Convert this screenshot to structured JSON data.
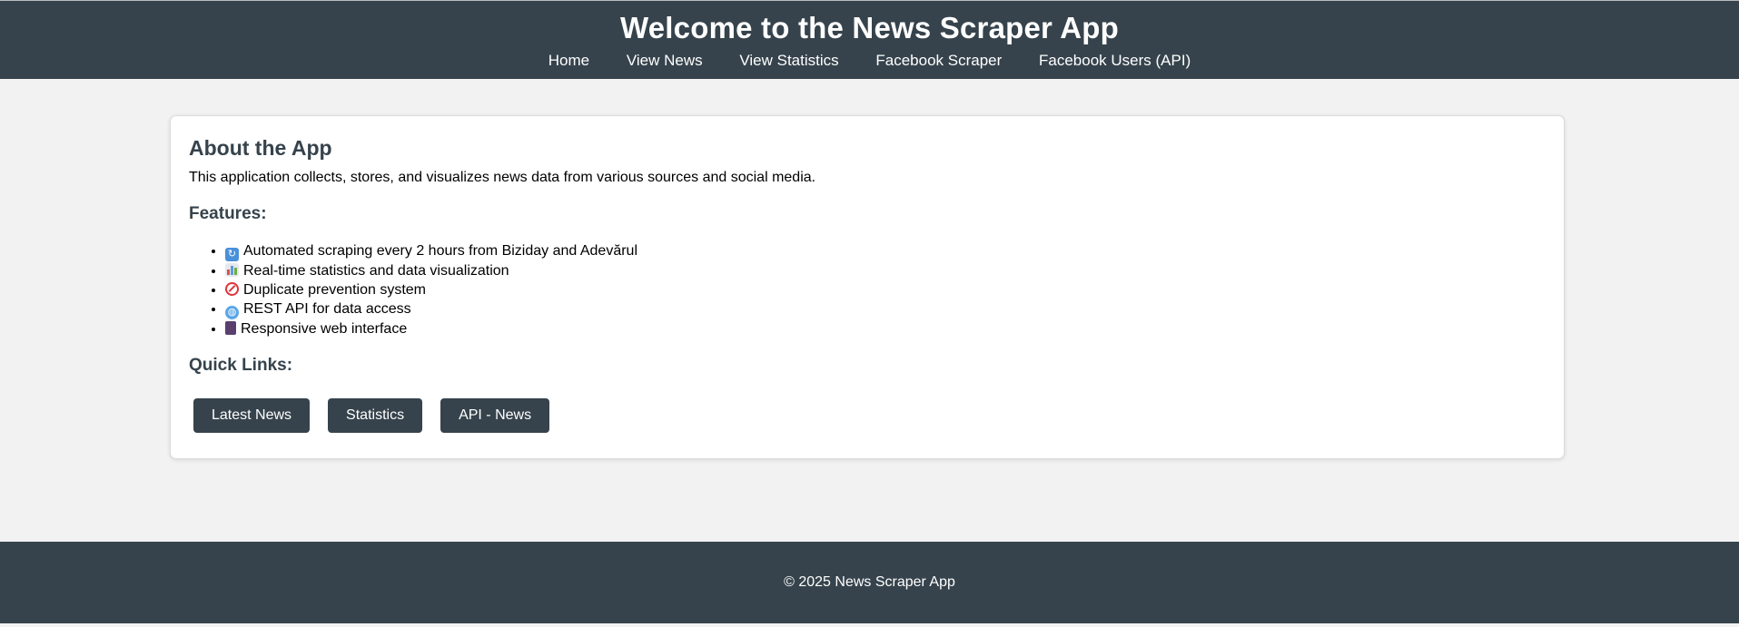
{
  "header": {
    "title": "Welcome to the News Scraper App",
    "nav": [
      {
        "label": "Home"
      },
      {
        "label": "View News"
      },
      {
        "label": "View Statistics"
      },
      {
        "label": "Facebook Scraper"
      },
      {
        "label": "Facebook Users (API)"
      }
    ]
  },
  "about": {
    "heading": "About the App",
    "description": "This application collects, stores, and visualizes news data from various sources and social media."
  },
  "features": {
    "heading": "Features:",
    "items": [
      {
        "icon": "refresh-emoji-icon",
        "text": "Automated scraping every 2 hours from Biziday and Adevărul"
      },
      {
        "icon": "bar-chart-emoji-icon",
        "text": "Real-time statistics and data visualization"
      },
      {
        "icon": "no-entry-emoji-icon",
        "text": "Duplicate prevention system"
      },
      {
        "icon": "globe-emoji-icon",
        "text": "REST API for data access"
      },
      {
        "icon": "mobile-phone-emoji-icon",
        "text": "Responsive web interface"
      }
    ]
  },
  "quick_links": {
    "heading": "Quick Links:",
    "buttons": [
      {
        "label": "Latest News"
      },
      {
        "label": "Statistics"
      },
      {
        "label": "API - News"
      }
    ]
  },
  "footer": {
    "text": "© 2025 News Scraper App"
  },
  "colors": {
    "header_bg": "#36434c",
    "page_bg": "#f2f2f2",
    "card_bg": "#ffffff",
    "accent_text": "#36434c"
  }
}
